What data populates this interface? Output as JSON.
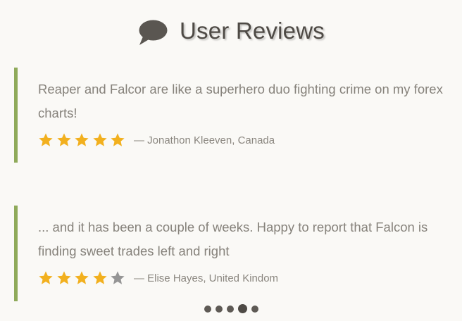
{
  "header": {
    "title": "User Reviews",
    "icon": "speech-bubble-icon"
  },
  "colors": {
    "accent_bar": "#8faa5a",
    "star_filled": "#f2b01e",
    "star_empty": "#959595",
    "background": "#faf9f6"
  },
  "reviews": [
    {
      "text": "Reaper and Falcor are like a superhero duo fighting crime on my forex charts!",
      "author": "— Jonathon Kleeven, Canada",
      "rating": 5,
      "max_rating": 5
    },
    {
      "text": "... and it has been a couple of weeks. Happy to report that Falcon is finding sweet trades left and right",
      "author": "— Elise Hayes, United Kindom",
      "rating": 4,
      "max_rating": 5
    }
  ],
  "pagination": {
    "total": 5,
    "active_index": 3
  }
}
